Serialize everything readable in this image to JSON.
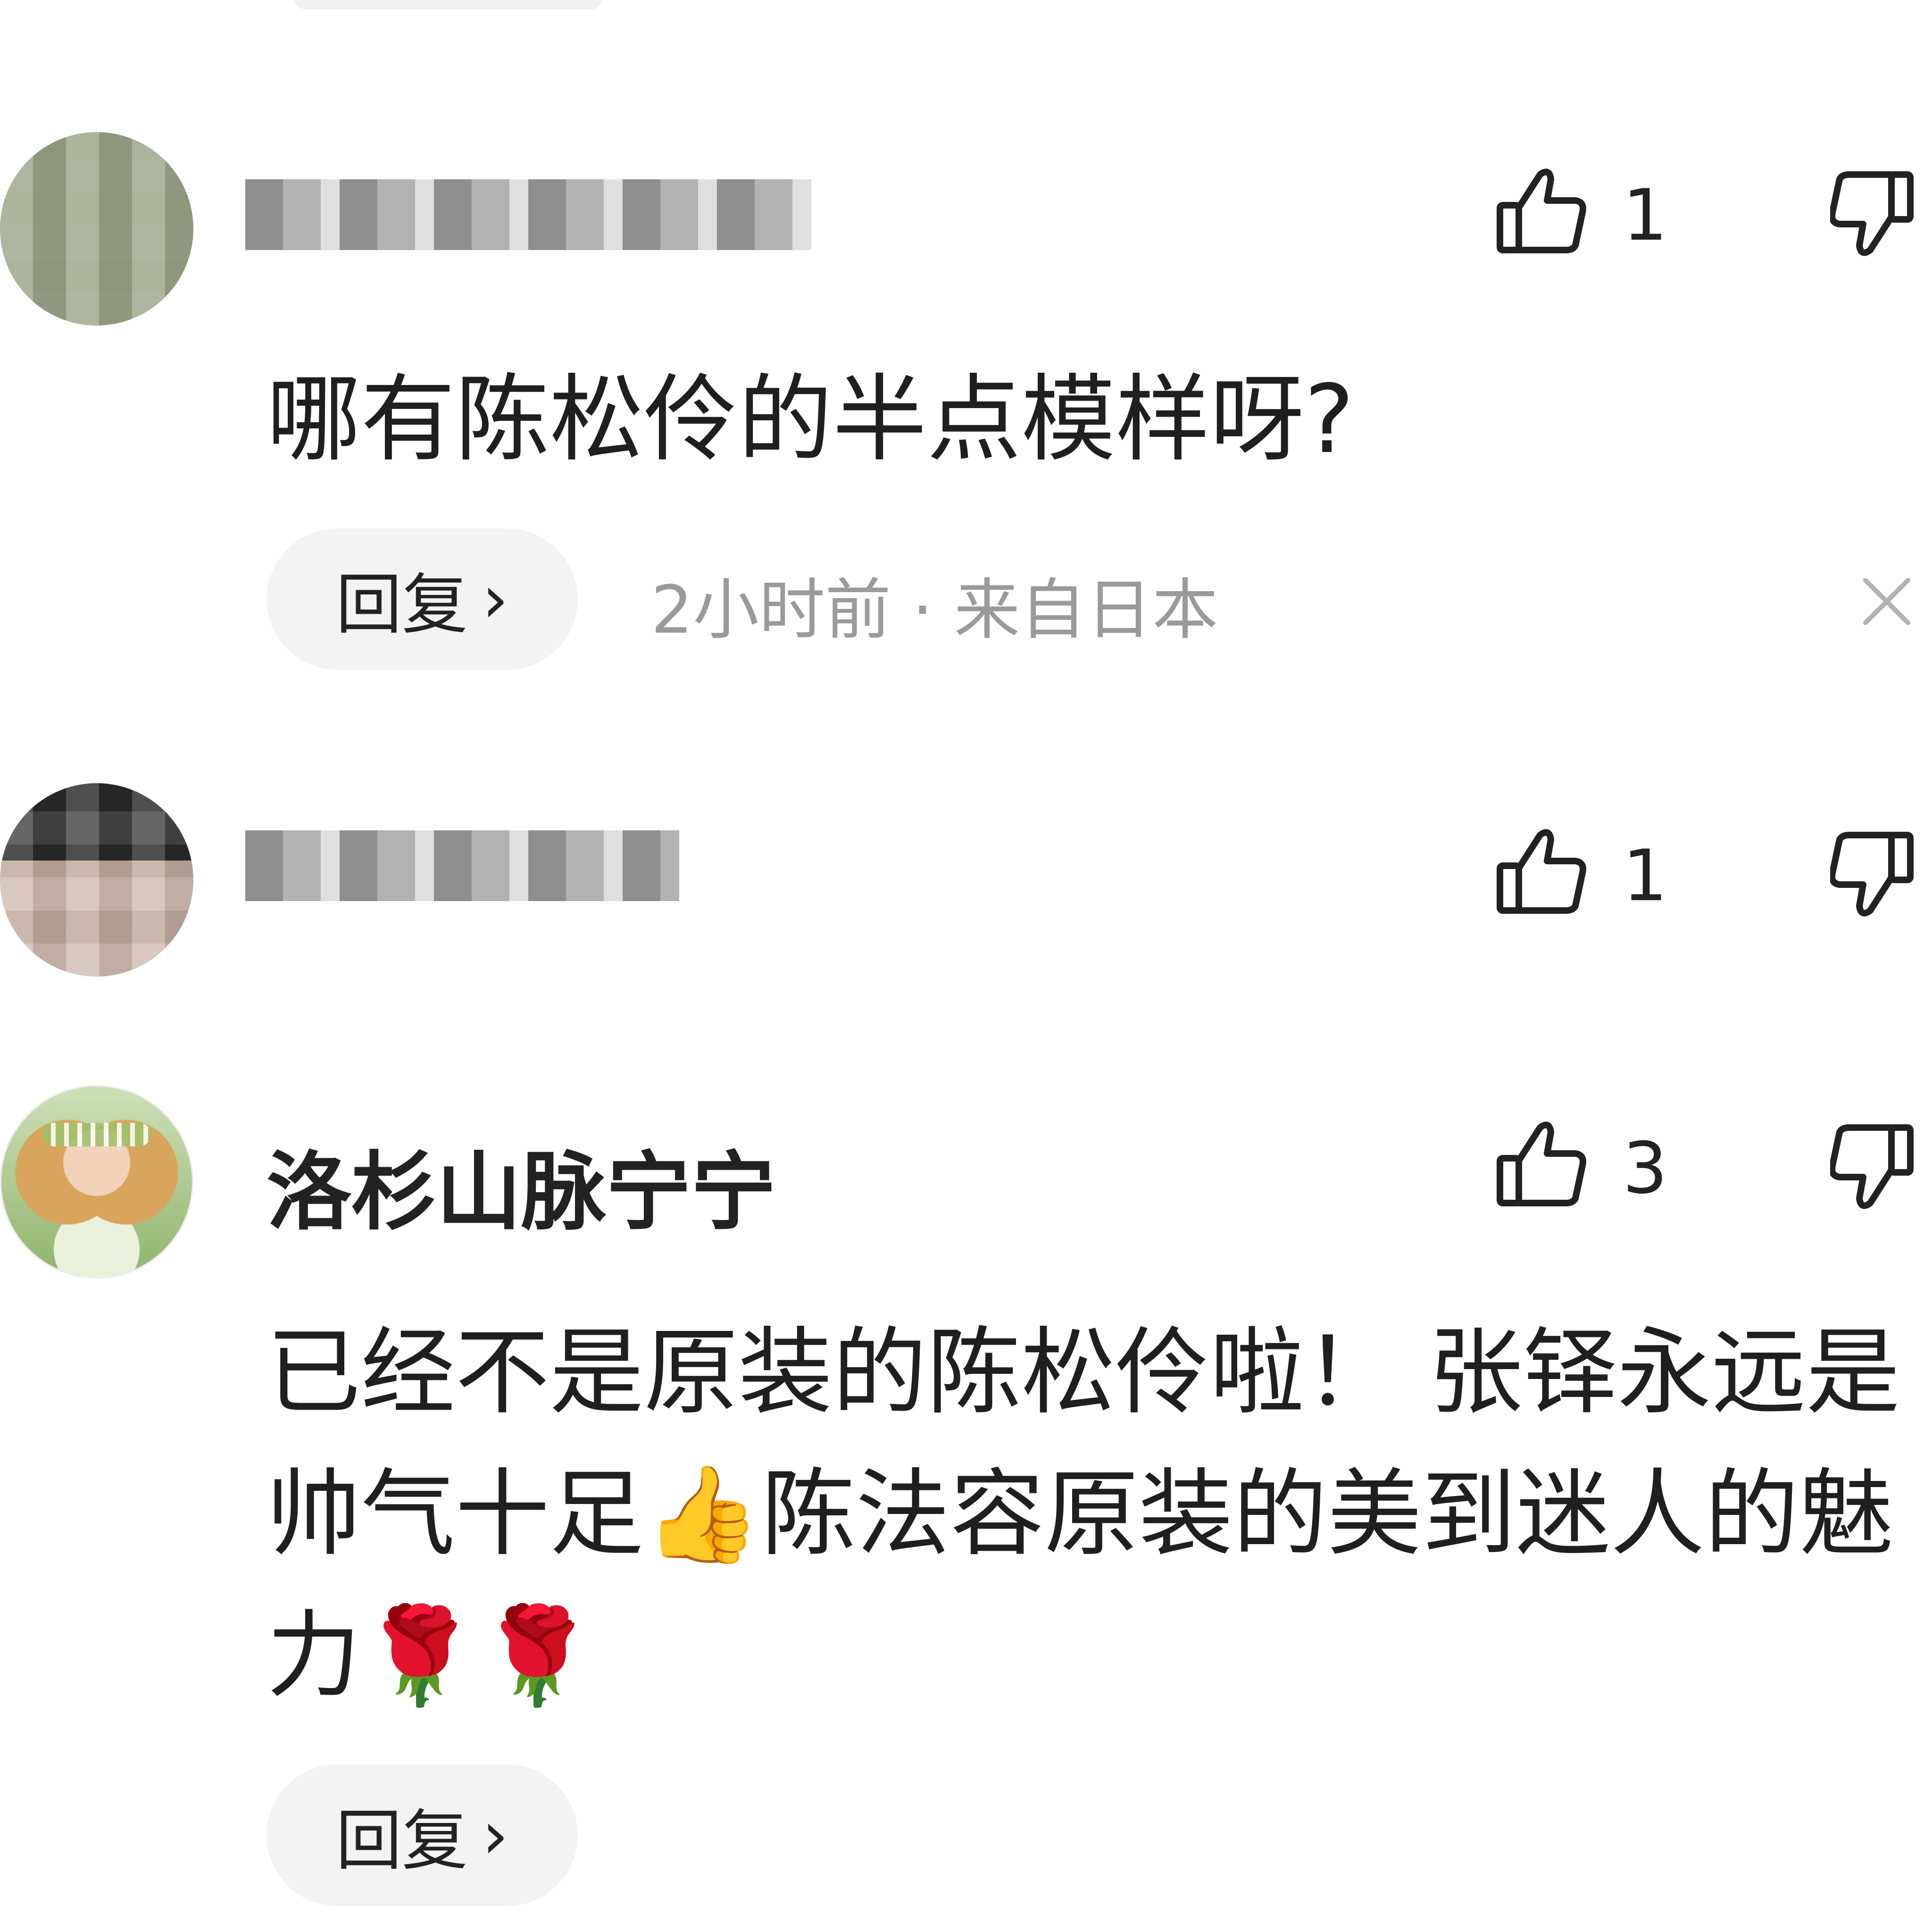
{
  "comments": [
    {
      "username": "",
      "likes": "1",
      "text": "哪有陈松伶的半点模样呀?",
      "reply_label": "回复",
      "meta": "2小时前 · 来自日本"
    },
    {
      "username": "",
      "likes": "1"
    },
    {
      "username": "洛杉山脉宁宁",
      "likes": "3",
      "text_lines": [
        "已经不是原装的陈松伶啦！ 张铎永远是",
        "帅气十足👍陈法容原装的美到迷人的魅",
        "力🌹🌹"
      ],
      "reply_label": "回复"
    }
  ],
  "icons": {
    "like": "thumbs-up-icon",
    "dislike": "thumbs-down-icon",
    "close": "close-icon",
    "reply_chevron": "chevron-right-icon"
  },
  "colors": {
    "text": "#1f1f1f",
    "meta": "#9a9a9a",
    "chip_bg": "#f3f3f3"
  }
}
